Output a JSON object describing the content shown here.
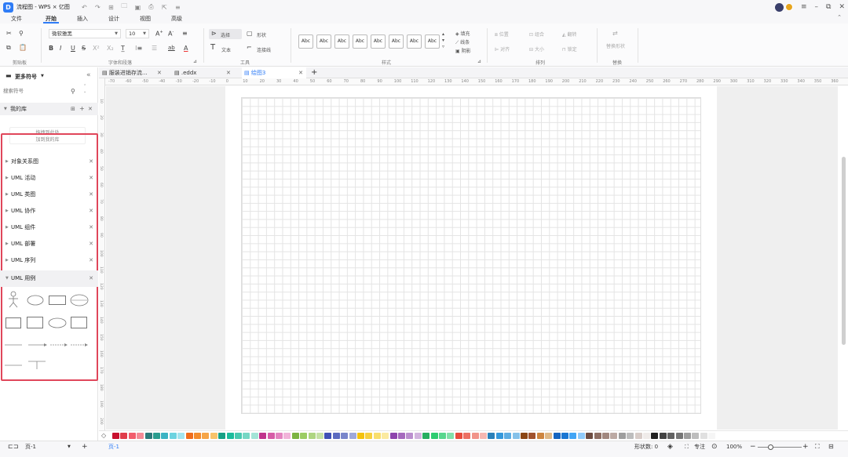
{
  "titlebar": {
    "app_title": "流程图 - WPS × 亿图"
  },
  "menu": {
    "tabs": [
      "文件",
      "开始",
      "插入",
      "设计",
      "视图",
      "高级"
    ],
    "active": "开始"
  },
  "ribbon": {
    "groups": [
      "剪贴板",
      "字体和段落",
      "工具",
      "样式",
      "排列",
      "替换"
    ],
    "font_family": "微软雅黑",
    "font_size": "10",
    "tools": {
      "select": "选择",
      "shape": "形状",
      "text": "文本",
      "connector": "连接线"
    },
    "style_preset": "Abc",
    "fill_items": [
      "填充",
      "线条",
      "阴影"
    ],
    "arrange_items": [
      "位置",
      "组合",
      "翻转",
      "对齐",
      "大小",
      "锁定"
    ],
    "replace_label": "替换形状"
  },
  "left_panel": {
    "title": "更多符号",
    "search_placeholder": "搜索符号",
    "my_library": "我的库",
    "drop_hint_1": "拖拽到此处",
    "drop_hint_2": "加到我的库",
    "libraries": [
      "对象关系图",
      "UML 活动",
      "UML 类图",
      "UML 协作",
      "UML 组件",
      "UML 部署",
      "UML 序列",
      "UML 用例"
    ]
  },
  "doc_tabs": [
    {
      "label": "服装进销存流...",
      "active": false
    },
    {
      "label": ".eddx",
      "active": false
    },
    {
      "label": "绘图3",
      "active": true
    }
  ],
  "ruler": {
    "h_labels": [
      "-70",
      "-60",
      "-50",
      "-40",
      "-30",
      "-20",
      "-10",
      "0",
      "10",
      "20",
      "30",
      "40",
      "50",
      "60",
      "70",
      "80",
      "90",
      "100",
      "110",
      "120",
      "130",
      "140",
      "150",
      "160",
      "170",
      "180",
      "190",
      "200",
      "210",
      "220",
      "230",
      "240",
      "250",
      "260",
      "270",
      "280",
      "290",
      "300",
      "310",
      "320",
      "330",
      "340",
      "350",
      "360"
    ],
    "v_labels": [
      "10",
      "20",
      "30",
      "40",
      "50",
      "60",
      "70",
      "80",
      "90",
      "100",
      "110",
      "120",
      "130",
      "140",
      "150",
      "160",
      "170",
      "180",
      "190",
      "200"
    ]
  },
  "palette": {
    "colors": [
      "#c8102e",
      "#e03c4a",
      "#f25c6c",
      "#f48a96",
      "#2c7a7b",
      "#2a9d8f",
      "#3bb3c3",
      "#6dd3e0",
      "#a3e4ee",
      "#ef6c1a",
      "#f38b2b",
      "#f6a547",
      "#f7c36b",
      "#16a085",
      "#1abc9c",
      "#48c9b0",
      "#76d7c4",
      "#a3e4d7",
      "#c0338c",
      "#d65ca7",
      "#e384c0",
      "#f1b3d9",
      "#7cb342",
      "#9ccc65",
      "#aed581",
      "#c5e1a5",
      "#3f51b5",
      "#5c6bc0",
      "#7986cb",
      "#9fa8da",
      "#f4c20d",
      "#f6d03f",
      "#f8de6e",
      "#fbeaa0",
      "#8e44ad",
      "#a569bd",
      "#bb8fce",
      "#d2b4de",
      "#27ae60",
      "#2ecc71",
      "#58d68d",
      "#82e0aa",
      "#e74c3c",
      "#ec7063",
      "#f1948a",
      "#f5b7b1",
      "#2980b9",
      "#3498db",
      "#5dade2",
      "#85c1e9",
      "#8b4513",
      "#a0522d",
      "#cd853f",
      "#deb887",
      "#1565c0",
      "#1976d2",
      "#42a5f5",
      "#90caf9",
      "#6d4c41",
      "#8d6e63",
      "#a1887f",
      "#bcaaa4",
      "#9e9e9e",
      "#bdbdbd",
      "#d7ccc8",
      "#efebe9",
      "#212121",
      "#424242",
      "#616161",
      "#757575",
      "#9e9e9e",
      "#bdbdbd",
      "#e0e0e0",
      "#f5f5f5"
    ]
  },
  "statusbar": {
    "page_label": "页-1",
    "page_tab": "页-1",
    "shape_count": "形状数: 0",
    "focus": "专注",
    "zoom": "100%"
  }
}
